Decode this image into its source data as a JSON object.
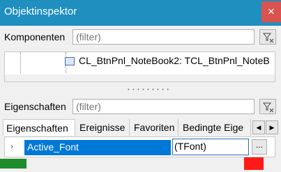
{
  "window": {
    "title": "Objektinspektor",
    "close_icon": "close-icon"
  },
  "components": {
    "label": "Komponenten",
    "filter_placeholder": "(filter)"
  },
  "tree": {
    "selected_item": "CL_BtnPnl_NoteBook2: TCL_BtnPnl_NoteB"
  },
  "properties": {
    "label": "Eigenschaften",
    "filter_placeholder": "(filter)"
  },
  "tabs": [
    {
      "label": "Eigenschaften"
    },
    {
      "label": "Ereignisse"
    },
    {
      "label": "Favoriten"
    },
    {
      "label": "Bedingte Eige"
    }
  ],
  "grid": {
    "row": {
      "name": "Active_Font",
      "value": "(TFont)",
      "edit_label": "..."
    }
  },
  "colors": {
    "titlebar": "#1f8fbf",
    "selection": "#0078d7"
  }
}
